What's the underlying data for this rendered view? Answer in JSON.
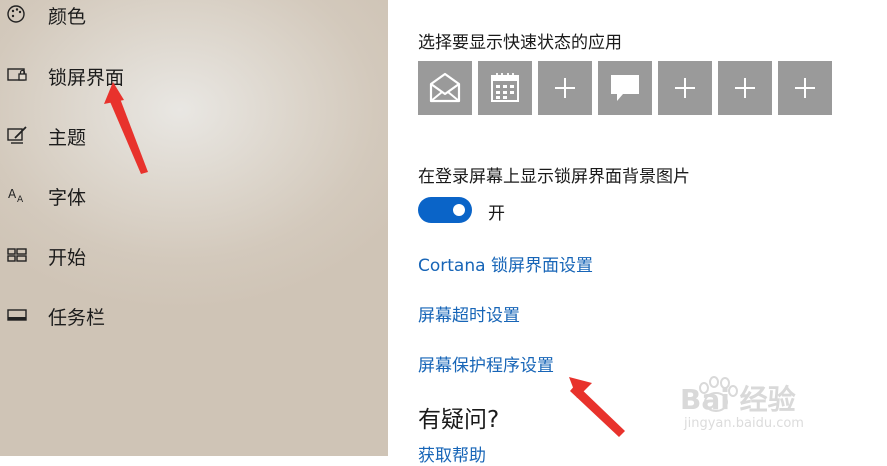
{
  "sidebar": {
    "items": [
      {
        "label": "颜色",
        "icon": "palette-icon"
      },
      {
        "label": "锁屏界面",
        "icon": "lock-screen-icon"
      },
      {
        "label": "主题",
        "icon": "theme-brush-icon"
      },
      {
        "label": "字体",
        "icon": "font-icon"
      },
      {
        "label": "开始",
        "icon": "start-grid-icon"
      },
      {
        "label": "任务栏",
        "icon": "taskbar-icon"
      }
    ]
  },
  "main": {
    "quick_status_heading": "选择要显示快速状态的应用",
    "quick_status_apps": [
      {
        "icon": "mail-icon"
      },
      {
        "icon": "calendar-icon"
      },
      {
        "icon": "plus-icon"
      },
      {
        "icon": "message-icon"
      },
      {
        "icon": "plus-icon"
      },
      {
        "icon": "plus-icon"
      },
      {
        "icon": "plus-icon"
      }
    ],
    "background_heading": "在登录屏幕上显示锁屏界面背景图片",
    "toggle": {
      "state_label": "开",
      "on": true
    },
    "links": {
      "cortana": "Cortana 锁屏界面设置",
      "screen_timeout": "屏幕超时设置",
      "screen_saver": "屏幕保护程序设置"
    },
    "help_title": "有疑问?",
    "help_link": "获取帮助"
  },
  "watermark": {
    "brand": "Bai 经验",
    "url": "jingyan.baidu.com"
  },
  "colors": {
    "accent": "#0a64c8",
    "link": "#1765b7",
    "tile": "#9a9a9a",
    "annotation_arrow": "#e8322c"
  }
}
